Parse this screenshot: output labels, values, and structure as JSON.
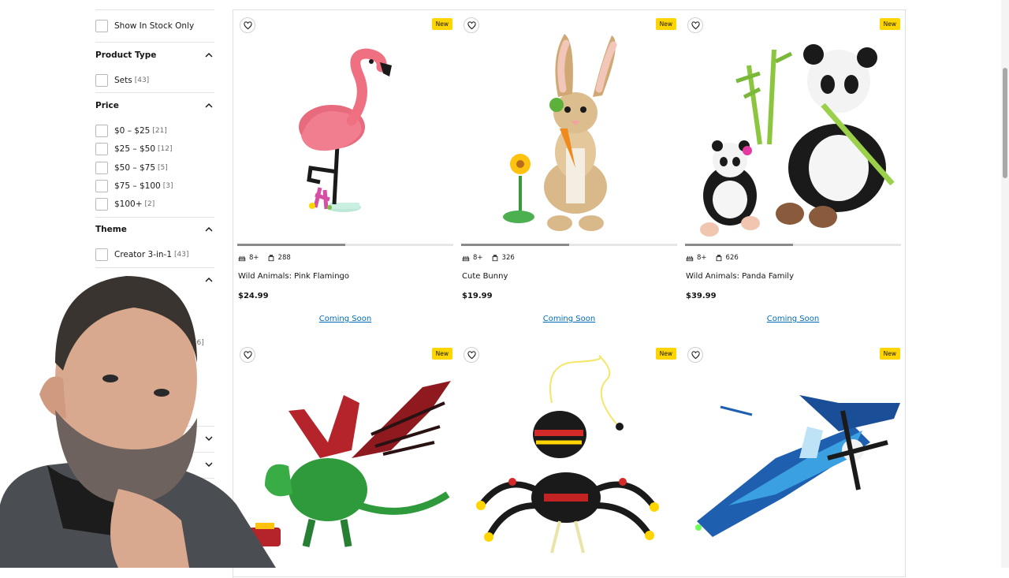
{
  "filters": {
    "in_stock_label": "Show In Stock Only",
    "product_type": {
      "title": "Product Type",
      "options": [
        {
          "label": "Sets",
          "count": "[43]"
        }
      ]
    },
    "price": {
      "title": "Price",
      "options": [
        {
          "label": "$0 – $25",
          "count": "[21]"
        },
        {
          "label": "$25 – $50",
          "count": "[12]"
        },
        {
          "label": "$50 – $75",
          "count": "[5]"
        },
        {
          "label": "$75 – $100",
          "count": "[3]"
        },
        {
          "label": "$100+",
          "count": "[2]"
        }
      ]
    },
    "theme": {
      "title": "Theme",
      "options": [
        {
          "label": "Creator 3-in-1",
          "count": "[43]"
        }
      ]
    },
    "partial_count": "[6]"
  },
  "products": [
    {
      "name": "Wild Animals: Pink Flamingo",
      "age": "8+",
      "pieces": "288",
      "price": "$24.99",
      "badge": "New",
      "cta": "Coming Soon",
      "image": "flamingo",
      "carousel_position": 0.5
    },
    {
      "name": "Cute Bunny",
      "age": "8+",
      "pieces": "326",
      "price": "$19.99",
      "badge": "New",
      "cta": "Coming Soon",
      "image": "bunny",
      "carousel_position": 0.5
    },
    {
      "name": "Wild Animals: Panda Family",
      "age": "8+",
      "pieces": "626",
      "price": "$39.99",
      "badge": "New",
      "cta": "Coming Soon",
      "image": "panda",
      "carousel_position": 0.5
    },
    {
      "badge": "New",
      "image": "dragon"
    },
    {
      "badge": "New",
      "image": "spider"
    },
    {
      "badge": "New",
      "image": "plane"
    }
  ],
  "colors": {
    "accent_link": "#006cb7",
    "badge": "#ffd500"
  }
}
